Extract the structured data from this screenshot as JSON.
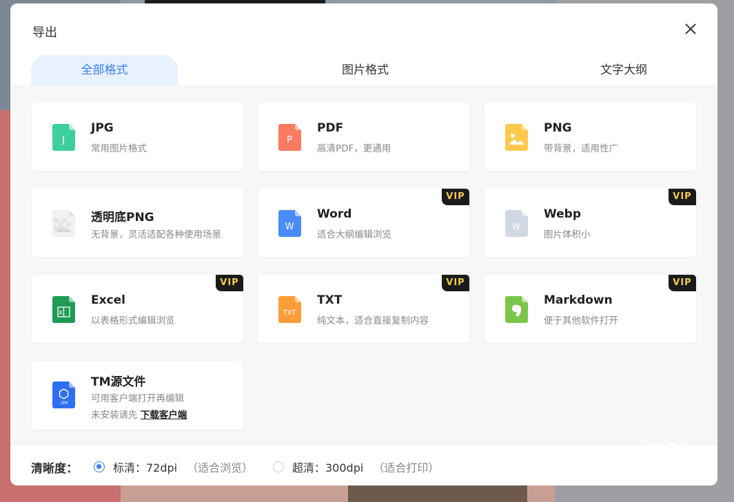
{
  "dialog": {
    "title": "导出"
  },
  "tabs": [
    {
      "label": "全部格式",
      "active": true
    },
    {
      "label": "图片格式",
      "active": false
    },
    {
      "label": "文字大纲",
      "active": false
    }
  ],
  "formats": [
    {
      "name": "JPG",
      "desc": "常用图片格式",
      "icon": "jpg-file-icon",
      "color": "#3ecf9e",
      "glyph": "J",
      "vip": false
    },
    {
      "name": "PDF",
      "desc": "高清PDF，更通用",
      "icon": "pdf-file-icon",
      "color": "#fb7a62",
      "glyph": "P",
      "vip": false
    },
    {
      "name": "PNG",
      "desc": "带背景，适用性广",
      "icon": "png-file-icon",
      "color": "#fec84b",
      "glyph": "",
      "vip": false
    },
    {
      "name": "透明底PNG",
      "desc": "无背景，灵活适配各种使用场景",
      "icon": "transparent-png-file-icon",
      "color": "#dddddd",
      "glyph": "",
      "vip": false
    },
    {
      "name": "Word",
      "desc": "适合大纲编辑浏览",
      "icon": "word-file-icon",
      "color": "#4a8cf7",
      "glyph": "W",
      "vip": true
    },
    {
      "name": "Webp",
      "desc": "图片体积小",
      "icon": "webp-file-icon",
      "color": "#cfd8e3",
      "glyph": "W",
      "vip": true
    },
    {
      "name": "Excel",
      "desc": "以表格形式编辑浏览",
      "icon": "excel-file-icon",
      "color": "#1f9b55",
      "glyph": "X",
      "vip": true
    },
    {
      "name": "TXT",
      "desc": "纯文本，适合直接复制内容",
      "icon": "txt-file-icon",
      "color": "#fd9d3a",
      "glyph": "TXT",
      "vip": true
    },
    {
      "name": "Markdown",
      "desc": "便于其他软件打开",
      "icon": "markdown-file-icon",
      "color": "#7cc54b",
      "glyph": "",
      "vip": true
    },
    {
      "name": "TM源文件",
      "desc": "可用客户端打开再编辑",
      "icon": "tm-file-icon",
      "color": "#2f6ff2",
      "glyph": ".tm",
      "vip": false,
      "desc2": "未安装请先",
      "link": "下载客户端"
    }
  ],
  "vip_label": "VIP",
  "footer": {
    "label": "清晰度：",
    "options": [
      {
        "label": "标清：72dpi",
        "hint": "（适合浏览）",
        "checked": true
      },
      {
        "label": "超清：300dpi",
        "hint": "（适合打印）",
        "checked": false
      }
    ]
  },
  "watermark": {
    "text": "Baidu经验",
    "sub": "jingyan.baidu.com"
  }
}
